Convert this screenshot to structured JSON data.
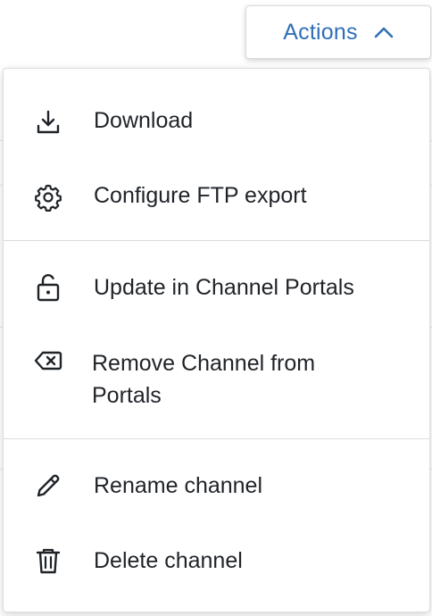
{
  "actions_button": {
    "label": "Actions",
    "icon": "chevron-up-icon",
    "color": "#2f6fb7"
  },
  "menu": {
    "groups": [
      [
        {
          "label": "Download",
          "icon": "download-icon"
        },
        {
          "label": "Configure FTP export",
          "icon": "gear-icon"
        }
      ],
      [
        {
          "label": "Update in Channel Portals",
          "icon": "unlock-icon"
        },
        {
          "label": "Remove Channel from Portals",
          "icon": "backspace-icon"
        }
      ],
      [
        {
          "label": "Rename channel",
          "icon": "pencil-icon"
        },
        {
          "label": "Delete channel",
          "icon": "trash-icon"
        }
      ]
    ]
  }
}
